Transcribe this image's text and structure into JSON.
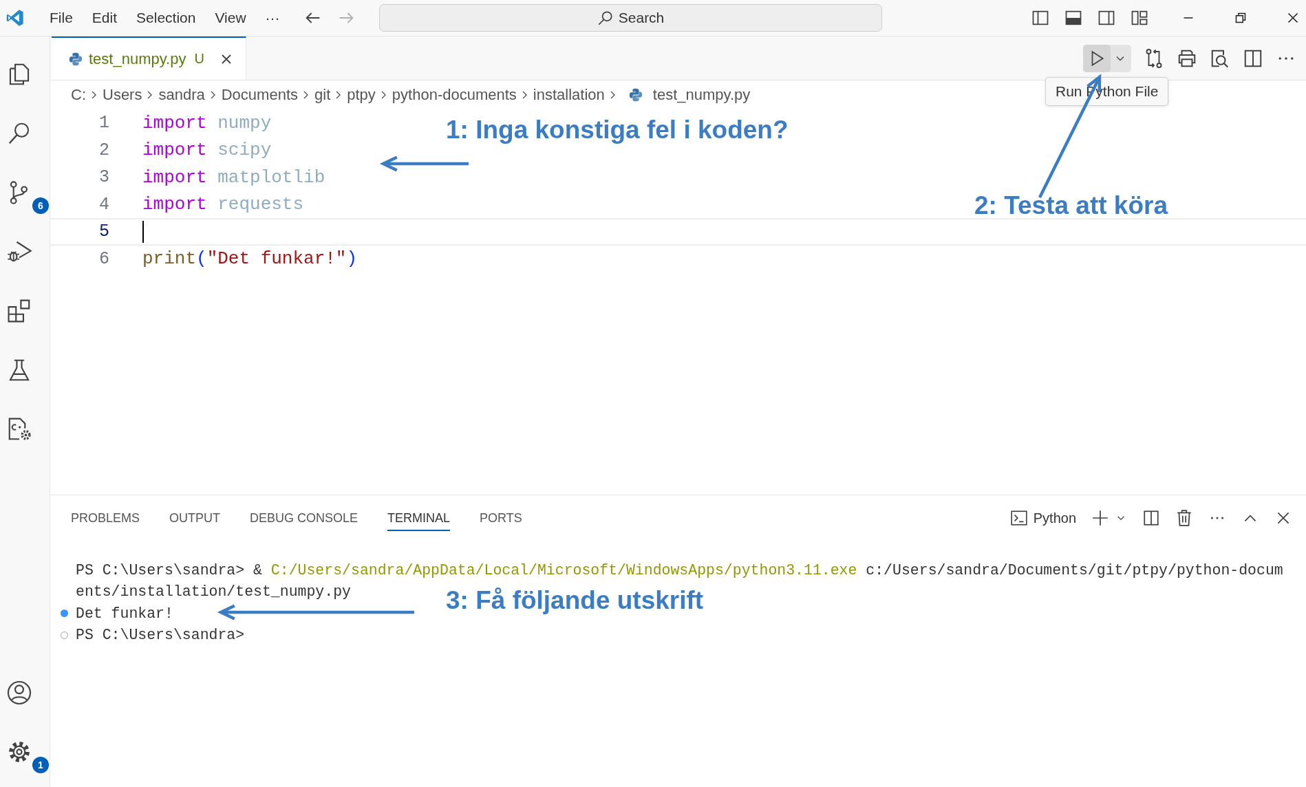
{
  "title_bar": {
    "menu": [
      {
        "label": "File"
      },
      {
        "label": "Edit"
      },
      {
        "label": "Selection"
      },
      {
        "label": "View"
      },
      {
        "label": "···"
      }
    ],
    "search": {
      "placeholder": "Search"
    }
  },
  "activity_bar": {
    "source_control_badge": "6",
    "settings_badge": "1"
  },
  "tabs": [
    {
      "label": "test_numpy.py",
      "status": "U",
      "selected": true
    }
  ],
  "tooltip": "Run Python File",
  "breadcrumb": [
    {
      "label": "C:",
      "file": false
    },
    {
      "label": "Users",
      "file": false
    },
    {
      "label": "sandra",
      "file": false
    },
    {
      "label": "Documents",
      "file": false
    },
    {
      "label": "git",
      "file": false
    },
    {
      "label": "ptpy",
      "file": false
    },
    {
      "label": "python-documents",
      "file": false
    },
    {
      "label": "installation",
      "file": false
    },
    {
      "label": "test_numpy.py",
      "file": true
    }
  ],
  "code_lines": [
    {
      "number": "1",
      "current": false,
      "tokens": [
        {
          "text": "import",
          "kind": "keyword"
        },
        {
          "text": "numpy",
          "kind": "unused"
        }
      ]
    },
    {
      "number": "2",
      "current": false,
      "tokens": [
        {
          "text": "import",
          "kind": "keyword"
        },
        {
          "text": "scipy",
          "kind": "unused"
        }
      ]
    },
    {
      "number": "3",
      "current": false,
      "tokens": [
        {
          "text": "import",
          "kind": "keyword"
        },
        {
          "text": "matplotlib",
          "kind": "unused"
        }
      ]
    },
    {
      "number": "4",
      "current": false,
      "tokens": [
        {
          "text": "import",
          "kind": "keyword"
        },
        {
          "text": "requests",
          "kind": "unused"
        }
      ]
    },
    {
      "number": "5",
      "current": true
    },
    {
      "number": "6",
      "current": false,
      "tokens": [
        {
          "text": "print",
          "kind": "function"
        },
        {
          "text": "(",
          "kind": "bracket"
        },
        {
          "text": "\"Det funkar!\"",
          "kind": "string"
        },
        {
          "text": ")",
          "kind": "bracket"
        }
      ]
    }
  ],
  "panel": {
    "tabs": [
      {
        "label": "PROBLEMS",
        "selected": false
      },
      {
        "label": "OUTPUT",
        "selected": false
      },
      {
        "label": "DEBUG CONSOLE",
        "selected": false
      },
      {
        "label": "TERMINAL",
        "selected": true
      },
      {
        "label": "PORTS",
        "selected": false
      }
    ],
    "terminal_profile": "Python",
    "terminal_lines": [
      {
        "segments": [
          {
            "text": "PS C:\\Users\\sandra> &",
            "kind": "plain"
          },
          {
            "text": "C:/Users/sandra/AppData/Local/Microsoft/WindowsApps/python3.11.exe",
            "kind": "path"
          },
          {
            "text": "c:/Users/sandra/Documents/git/ptpy/python-docum",
            "kind": "plain"
          }
        ]
      },
      {
        "segments": [
          {
            "text": "ents/installation/test_numpy.py",
            "kind": "plain"
          }
        ]
      },
      {
        "marker": true,
        "success": true,
        "segments": [
          {
            "text": "Det funkar!",
            "kind": "plain"
          }
        ]
      },
      {
        "marker": true,
        "success": false,
        "segments": [
          {
            "text": "PS C:\\Users\\sandra>",
            "kind": "plain"
          }
        ]
      }
    ]
  },
  "annotations": [
    {
      "text": "1: Inga konstiga fel i koden?"
    },
    {
      "text": "2: Testa att köra"
    },
    {
      "text": "3: Få följande utskrift"
    }
  ]
}
